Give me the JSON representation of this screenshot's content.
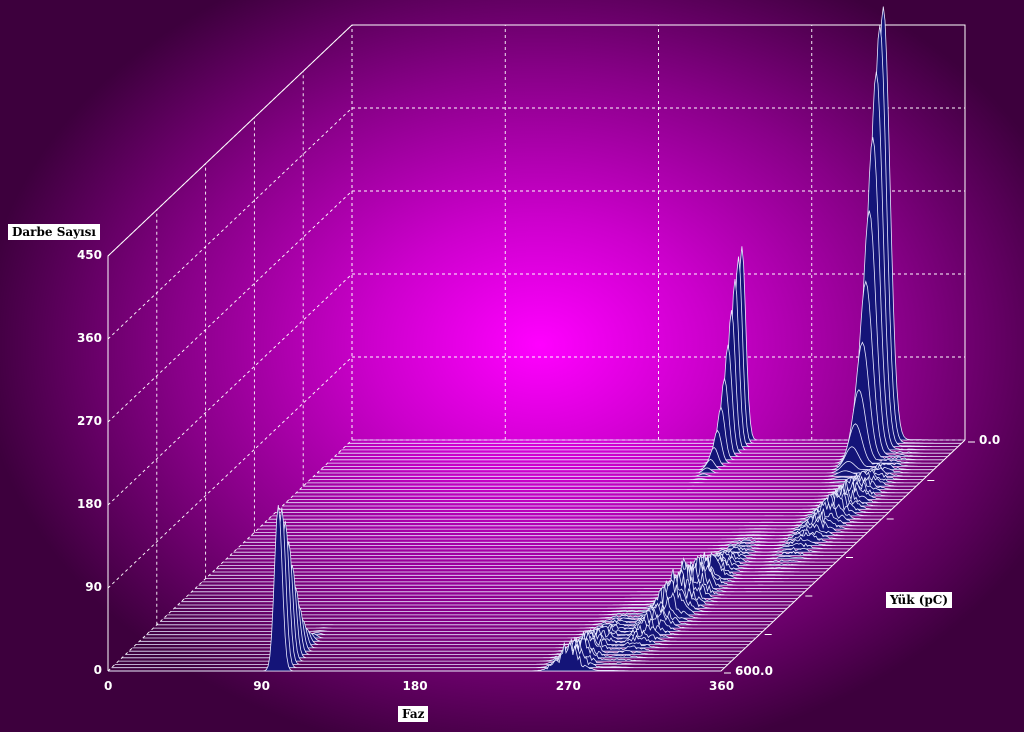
{
  "chart_data": {
    "type": "surface3d",
    "zlabel": "Darbe Sayısı",
    "xlabel": "Faz",
    "ylabel": "Yük (pC)",
    "z_ticks": [
      "0",
      "90",
      "180",
      "270",
      "360",
      "450"
    ],
    "x_ticks": [
      "0",
      "90",
      "180",
      "270",
      "360"
    ],
    "y_ticks": [
      "0.0",
      "600.0"
    ],
    "zlim": [
      0,
      450
    ],
    "xlim": [
      0,
      360
    ],
    "ylim": [
      0.0,
      600.0
    ],
    "peaks": [
      {
        "phase": 100,
        "charge": 0,
        "count": 180
      },
      {
        "phase": 229,
        "charge": 600,
        "count": 210
      },
      {
        "phase": 270,
        "charge": 0,
        "count": 25
      },
      {
        "phase": 295,
        "charge": 180,
        "count": 35
      },
      {
        "phase": 330,
        "charge": 420,
        "count": 20
      },
      {
        "phase": 312,
        "charge": 600,
        "count": 470
      }
    ]
  }
}
